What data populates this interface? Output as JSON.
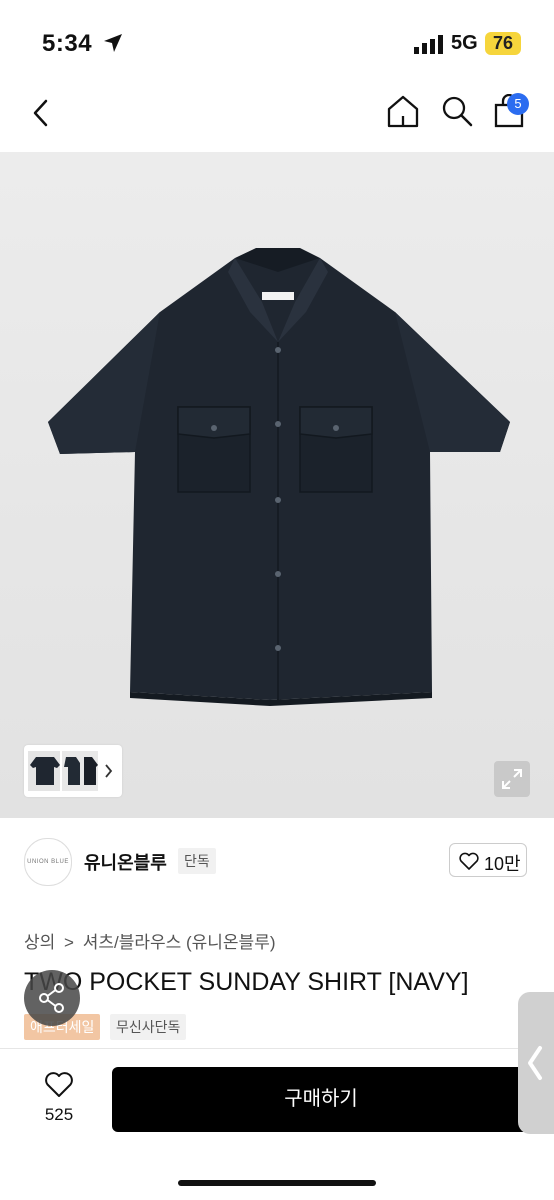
{
  "status": {
    "time": "5:34",
    "network": "5G",
    "battery": "76"
  },
  "nav": {
    "cart_count": "5"
  },
  "brand": {
    "logo_text": "UNION BLUE",
    "name": "유니온블루",
    "tag": "단독",
    "like_count": "10만"
  },
  "breadcrumb": {
    "level1": "상의",
    "separator": ">",
    "level2": "셔츠/블라우스 (유니온블루)"
  },
  "product": {
    "title": "TWO POCKET SUNDAY SHIRT [NAVY]",
    "tags": [
      "애프터세일",
      "무신사단독"
    ]
  },
  "bottom": {
    "wishlist_count": "525",
    "buy_label": "구매하기"
  },
  "colors": {
    "accent_blue": "#2b6cf0",
    "shirt_navy": "#1f2630",
    "buy_bg": "#000000",
    "sale_tag": "#f2c6a3"
  },
  "icons": [
    "back-icon",
    "home-icon",
    "search-icon",
    "cart-icon",
    "expand-icon",
    "chevron-right-icon",
    "heart-icon",
    "share-icon",
    "location-arrow-icon",
    "signal-icon"
  ]
}
